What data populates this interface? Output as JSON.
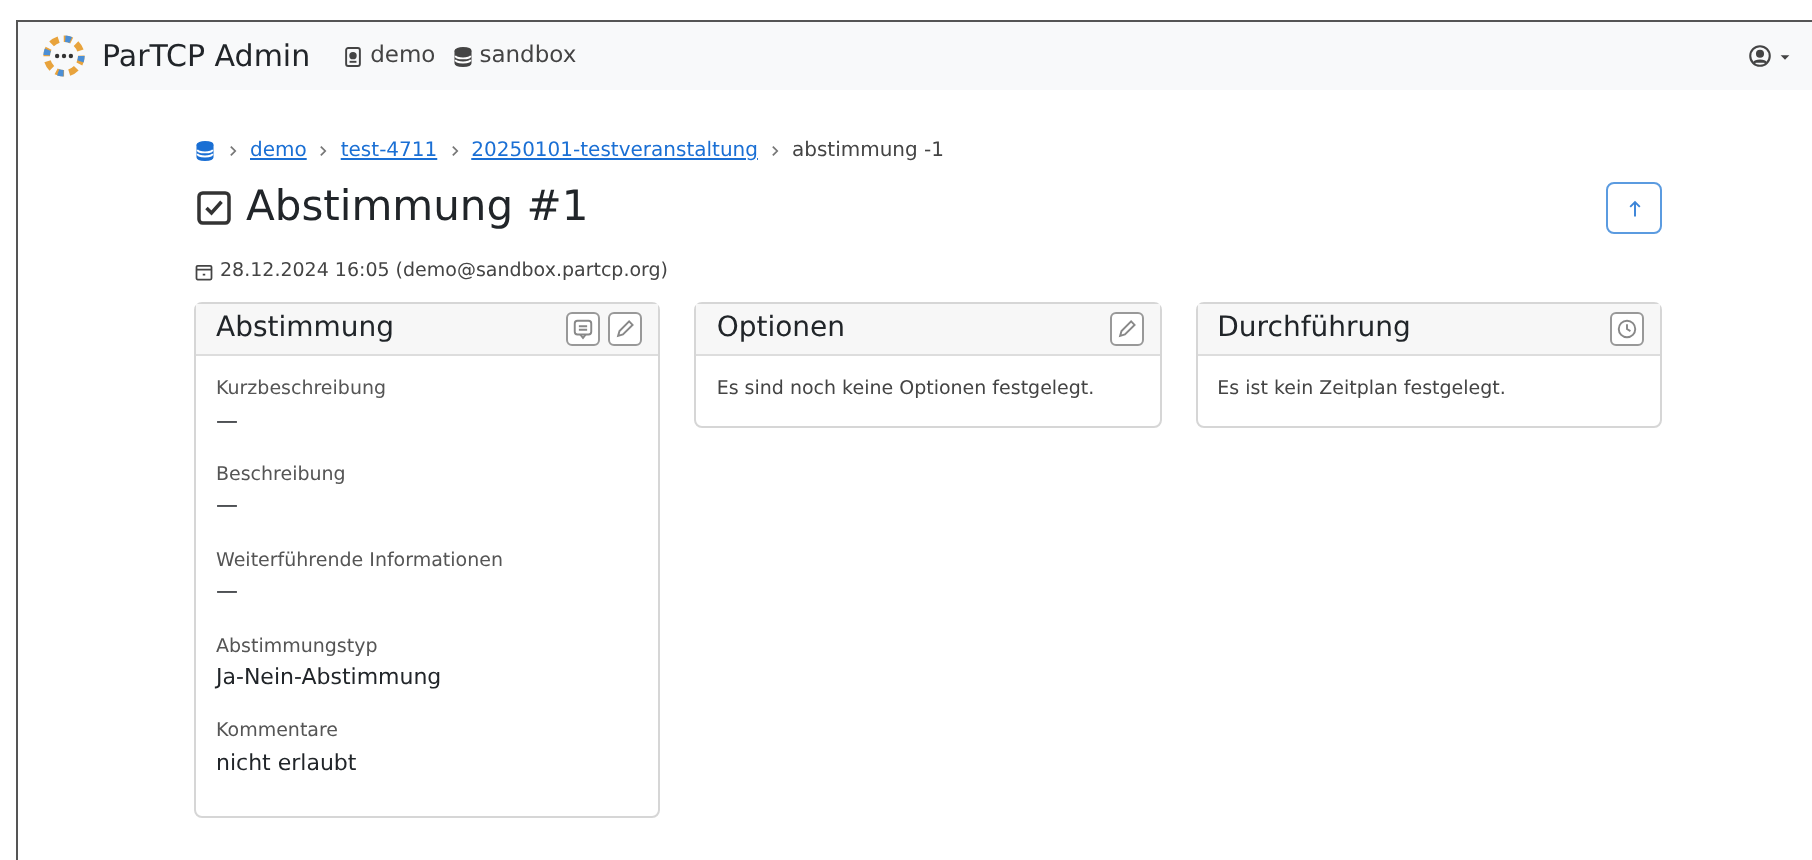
{
  "navbar": {
    "brand": "ParTCP Admin",
    "items": [
      {
        "kind": "badge",
        "label": "demo"
      },
      {
        "kind": "database",
        "label": "sandbox"
      }
    ]
  },
  "breadcrumb": [
    {
      "kind": "home"
    },
    {
      "kind": "link",
      "label": "demo"
    },
    {
      "kind": "link",
      "label": "test-4711"
    },
    {
      "kind": "link",
      "label": "20250101-testveranstaltung"
    },
    {
      "kind": "current",
      "label": "abstimmung -1"
    }
  ],
  "title": "Abstimmung #1",
  "meta": "28.12.2024 16:05 (demo@sandbox.partcp.org)",
  "cards": [
    {
      "title": "Abstimmung",
      "actions": [
        {
          "kind": "comment"
        },
        {
          "kind": "edit"
        }
      ],
      "fields": [
        {
          "label": "Kurzbeschreibung",
          "value": "—"
        },
        {
          "label": "Beschreibung",
          "value": "—"
        },
        {
          "label": "Weiterführende Informationen",
          "value": "—"
        },
        {
          "label": "Abstimmungstyp",
          "value": "Ja-Nein-Abstimmung"
        },
        {
          "label": "Kommentare",
          "value": "nicht erlaubt"
        }
      ]
    },
    {
      "title": "Optionen",
      "actions": [
        {
          "kind": "edit"
        }
      ],
      "text": "Es sind noch keine Optionen festgelegt."
    },
    {
      "title": "Durchführung",
      "actions": [
        {
          "kind": "clock"
        }
      ],
      "text": "Es ist kein Zeitplan festgelegt."
    }
  ]
}
